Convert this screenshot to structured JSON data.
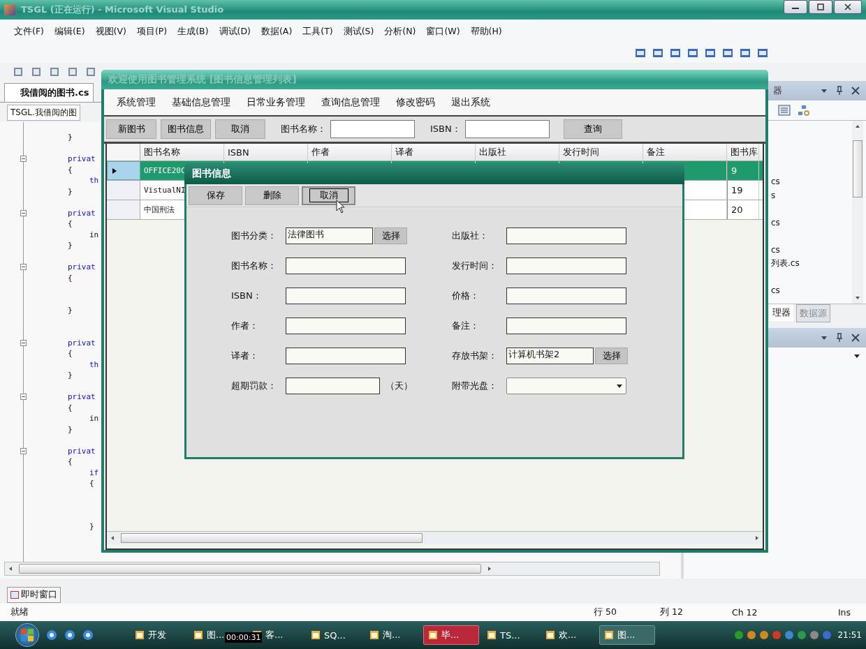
{
  "ide": {
    "title": "TSGL (正在运行) - Microsoft Visual Studio",
    "menu": [
      "文件(F)",
      "编辑(E)",
      "视图(V)",
      "项目(P)",
      "生成(B)",
      "调试(D)",
      "数据(A)",
      "工具(T)",
      "测试(S)",
      "分析(N)",
      "窗口(W)",
      "帮助(H)"
    ],
    "doc_tab": "我借阅的图书.cs",
    "nav_combo": "TSGL.我借阅的图",
    "code": [
      {
        "kind": "brace",
        "text": "}"
      },
      {
        "kind": "blank"
      },
      {
        "kind": "declaration",
        "text": "privat"
      },
      {
        "kind": "brace",
        "text": "{"
      },
      {
        "kind": "inner",
        "text": "th",
        "keyword": true
      },
      {
        "kind": "brace",
        "text": "}"
      },
      {
        "kind": "blank"
      },
      {
        "kind": "declaration",
        "text": "privat"
      },
      {
        "kind": "brace",
        "text": "{"
      },
      {
        "kind": "inner",
        "text": "in",
        "keyword": false
      },
      {
        "kind": "brace",
        "text": "}"
      },
      {
        "kind": "blank"
      },
      {
        "kind": "declaration",
        "text": "privat"
      },
      {
        "kind": "brace",
        "text": "{"
      },
      {
        "kind": "blank"
      },
      {
        "kind": "blank"
      },
      {
        "kind": "brace",
        "text": "}"
      },
      {
        "kind": "blank"
      },
      {
        "kind": "blank"
      },
      {
        "kind": "declaration",
        "text": "privat"
      },
      {
        "kind": "brace",
        "text": "{"
      },
      {
        "kind": "inner",
        "text": "th",
        "keyword": true
      },
      {
        "kind": "brace",
        "text": "}"
      },
      {
        "kind": "blank"
      },
      {
        "kind": "declaration",
        "text": "privat"
      },
      {
        "kind": "brace",
        "text": "{"
      },
      {
        "kind": "inner",
        "text": "in",
        "keyword": false
      },
      {
        "kind": "brace",
        "text": "}"
      },
      {
        "kind": "blank"
      },
      {
        "kind": "declaration",
        "text": "privat"
      },
      {
        "kind": "brace",
        "text": "{"
      },
      {
        "kind": "inner",
        "text": "if",
        "keyword": true
      },
      {
        "kind": "inner",
        "text": "{",
        "keyword": false
      },
      {
        "kind": "blank"
      },
      {
        "kind": "blank"
      },
      {
        "kind": "blank"
      },
      {
        "kind": "inner",
        "text": "}",
        "keyword": false
      }
    ],
    "right_pane": {
      "header": "器",
      "items": [
        {
          "kind": "blank"
        },
        {
          "kind": "blank"
        },
        {
          "kind": "blank"
        },
        {
          "kind": "blank"
        },
        {
          "kind": "file",
          "text": "cs"
        },
        {
          "kind": "file",
          "text": "s"
        },
        {
          "kind": "blank"
        },
        {
          "kind": "file",
          "text": "cs"
        },
        {
          "kind": "blank"
        },
        {
          "kind": "file",
          "text": "cs"
        },
        {
          "kind": "file",
          "text": "列表.cs"
        },
        {
          "kind": "blank"
        },
        {
          "kind": "file",
          "text": "cs"
        }
      ],
      "tabs": [
        {
          "label": "理器",
          "selected": true
        },
        {
          "label": "数据源",
          "selected": false
        }
      ]
    },
    "bottom_tab": "即时窗口",
    "status": {
      "text": "就绪",
      "line": "行 50",
      "column": "列 12",
      "char": "Ch 12",
      "mode": "Ins"
    }
  },
  "app": {
    "title": "欢迎使用图书管理系统 [图书信息管理列表]",
    "menu": [
      "系统管理",
      "基础信息管理",
      "日常业务管理",
      "查询信息管理",
      "修改密码",
      "退出系统"
    ],
    "buttons": [
      "新图书",
      "图书信息",
      "取消"
    ],
    "search_fields": [
      {
        "label": "图书名称："
      },
      {
        "label": "ISBN："
      }
    ],
    "search_button": "查询",
    "columns": [
      "图书名称",
      "ISBN",
      "作者",
      "译者",
      "出版社",
      "发行时间",
      "备注",
      "图书库"
    ],
    "rows": [
      {
        "selected": true,
        "name": "OFFICE20C",
        "library": "9"
      },
      {
        "selected": false,
        "name": "VistualNI",
        "library": "19"
      },
      {
        "selected": false,
        "name": "中国刑法",
        "library": "20"
      }
    ]
  },
  "dialog": {
    "title": "图书信息",
    "buttons": [
      {
        "label": "保存",
        "focused": false
      },
      {
        "label": "删除",
        "focused": false
      },
      {
        "label": "取消",
        "focused": true
      }
    ],
    "left": [
      {
        "kind": "picker",
        "label": "图书分类：",
        "value": "法律图书",
        "button": "选择"
      },
      {
        "kind": "text",
        "label": "图书名称："
      },
      {
        "kind": "text",
        "label": "ISBN："
      },
      {
        "kind": "text",
        "label": "作者："
      },
      {
        "kind": "text",
        "label": "译者："
      },
      {
        "kind": "unit",
        "label": "超期罚款：",
        "unit": "（天）"
      }
    ],
    "right": [
      {
        "kind": "text",
        "label": "出版社："
      },
      {
        "kind": "text",
        "label": "发行时间："
      },
      {
        "kind": "text",
        "label": "价格："
      },
      {
        "kind": "text",
        "label": "备注："
      },
      {
        "kind": "picker",
        "label": "存放书架：",
        "value": "计算机书架2",
        "button": "选择"
      },
      {
        "kind": "dropdown",
        "label": "附带光盘："
      }
    ]
  },
  "taskbar": {
    "items": [
      {
        "label": "开发",
        "selected": false,
        "alert": false
      },
      {
        "label": "图...",
        "selected": false,
        "alert": false
      },
      {
        "label": "客...",
        "selected": false,
        "alert": false
      },
      {
        "label": "SQ...",
        "selected": false,
        "alert": false
      },
      {
        "label": "淘...",
        "selected": false,
        "alert": false
      },
      {
        "label": "毕...",
        "selected": false,
        "alert": true
      },
      {
        "label": "TS...",
        "selected": false,
        "alert": false
      },
      {
        "label": "欢...",
        "selected": false,
        "alert": false
      },
      {
        "label": "图...",
        "selected": true,
        "alert": false
      }
    ],
    "clock": "21:51"
  },
  "recording_timer": "00:00:31"
}
